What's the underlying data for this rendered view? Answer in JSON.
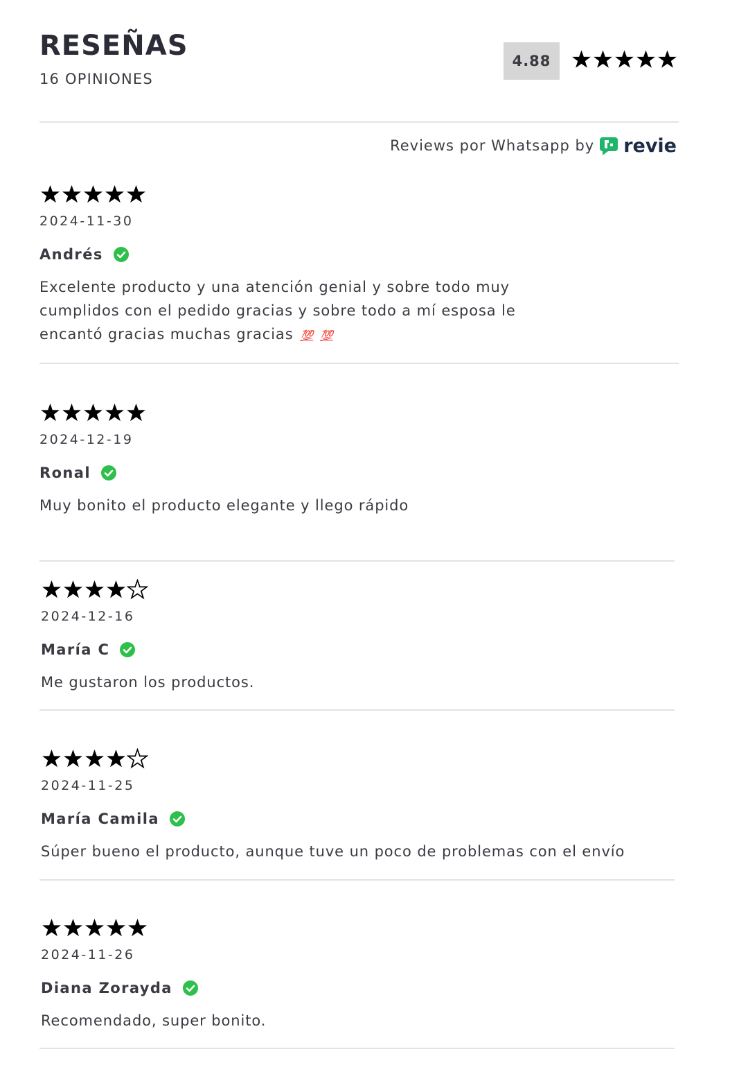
{
  "header": {
    "title": "RESEÑAS",
    "subtitle": "16 OPINIONES",
    "average": "4.88",
    "average_stars": 5
  },
  "powered_by": {
    "text": "Reviews por Whatsapp by",
    "brand": "revie",
    "brand_color": "#1fb56a"
  },
  "colors": {
    "star": "#000000",
    "verified": "#2ec04a",
    "divider": "#e3e3e3",
    "rating_box": "#d6d6d6",
    "emoji_100": "#e0306a"
  },
  "reviews": [
    {
      "rating": 5,
      "date": "2024-11-30",
      "author": "Andrés",
      "text": "Excelente producto y una atención genial y sobre todo muy cumplidos con el pedido gracias y sobre todo a mí esposa le encantó gracias muchas gracias",
      "emoji": [
        "💯",
        "💯"
      ]
    },
    {
      "rating": 5,
      "date": "2024-12-19",
      "author": "Ronal",
      "text": "Muy bonito el producto elegante y llego rápido"
    },
    {
      "rating": 4,
      "date": "2024-12-16",
      "author": "María C",
      "text": "Me gustaron los productos."
    },
    {
      "rating": 4,
      "date": "2024-11-25",
      "author": "María Camila",
      "text": "Súper bueno el producto, aunque tuve un poco de problemas con el envío"
    },
    {
      "rating": 5,
      "date": "2024-11-26",
      "author": "Diana Zorayda",
      "text": "Recomendado, super bonito."
    }
  ]
}
